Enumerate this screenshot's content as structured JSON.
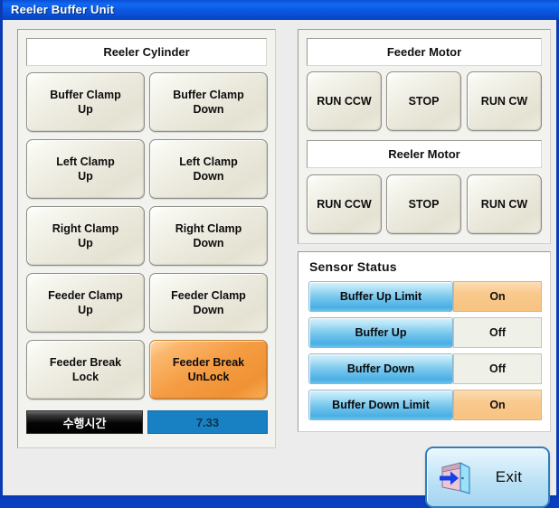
{
  "window": {
    "title": "Reeler Buffer Unit"
  },
  "reeler_cylinder": {
    "header": "Reeler Cylinder",
    "buttons": [
      {
        "label": "Buffer Clamp\nUp",
        "state": "normal"
      },
      {
        "label": "Buffer Clamp\nDown",
        "state": "normal"
      },
      {
        "label": "Left Clamp\nUp",
        "state": "normal"
      },
      {
        "label": "Left Clamp\nDown",
        "state": "normal"
      },
      {
        "label": "Right Clamp\nUp",
        "state": "normal"
      },
      {
        "label": "Right Clamp\nDown",
        "state": "normal"
      },
      {
        "label": "Feeder Clamp\nUp",
        "state": "normal"
      },
      {
        "label": "Feeder Clamp\nDown",
        "state": "normal"
      },
      {
        "label": "Feeder Break\nLock",
        "state": "normal"
      },
      {
        "label": "Feeder Break\nUnLock",
        "state": "active"
      }
    ]
  },
  "timer": {
    "label": "수행시간",
    "value": "7.33"
  },
  "feeder_motor": {
    "header": "Feeder Motor",
    "buttons": [
      {
        "label": "RUN CCW"
      },
      {
        "label": "STOP"
      },
      {
        "label": "RUN CW"
      }
    ]
  },
  "reeler_motor": {
    "header": "Reeler Motor",
    "buttons": [
      {
        "label": "RUN CCW"
      },
      {
        "label": "STOP"
      },
      {
        "label": "RUN CW"
      }
    ]
  },
  "sensor_status": {
    "title": "Sensor Status",
    "rows": [
      {
        "name": "Buffer Up Limit",
        "value": "On"
      },
      {
        "name": "Buffer Up",
        "value": "Off"
      },
      {
        "name": "Buffer Down",
        "value": "Off"
      },
      {
        "name": "Buffer Down Limit",
        "value": "On"
      }
    ]
  },
  "exit": {
    "label": "Exit",
    "icon": "exit-door-icon"
  },
  "colors": {
    "titlebar": "#0a57e2",
    "window_border": "#0a3bb5",
    "background": "#ececec",
    "button_face": "#eceade",
    "button_active": "#f59c43",
    "sensor_name": "#79c7ee",
    "sensor_on": "#f9c98c",
    "sensor_off": "#eff1e9",
    "timer_value": "#1781c4",
    "exit_face": "#b8e0f5"
  }
}
